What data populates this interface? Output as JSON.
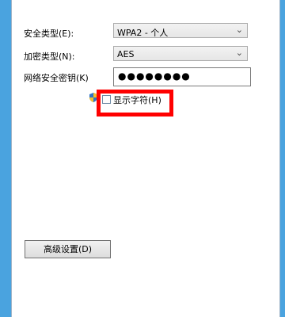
{
  "form": {
    "security_type": {
      "label": "安全类型(E):",
      "value": "WPA2 - 个人"
    },
    "encryption_type": {
      "label": "加密类型(N):",
      "value": "AES"
    },
    "security_key": {
      "label": "网络安全密钥(K)",
      "value": "●●●●●●●●"
    },
    "show_chars": {
      "label": "显示字符(H)",
      "checked": false
    }
  },
  "buttons": {
    "advanced": "高级设置(D)"
  },
  "icons": {
    "dropdown": "chevron-down-icon",
    "shield": "uac-shield-icon"
  }
}
